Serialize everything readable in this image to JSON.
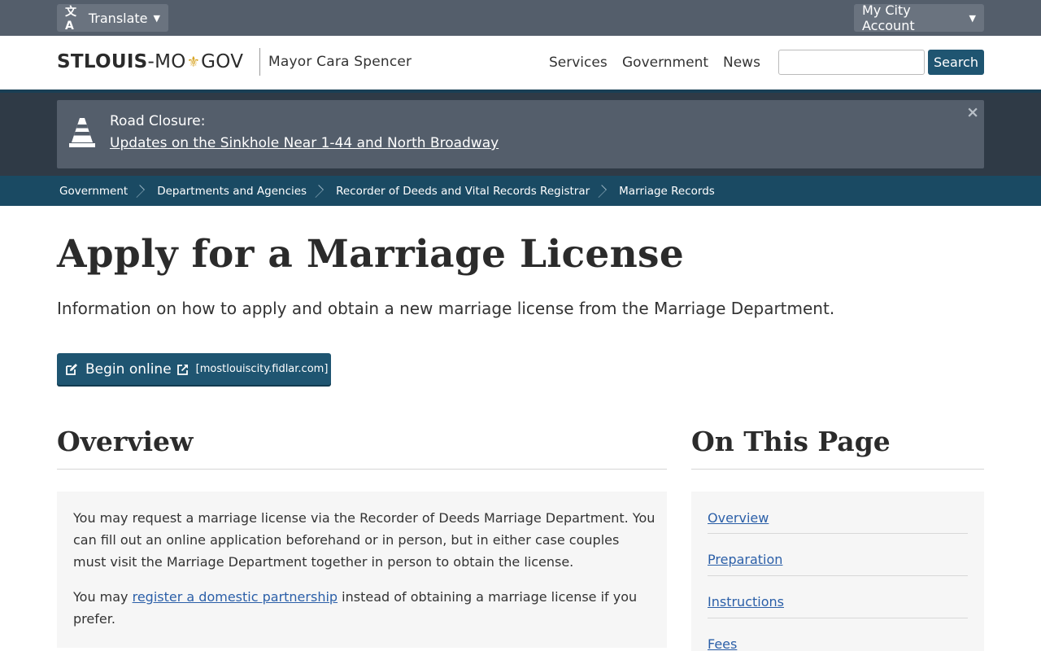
{
  "utility": {
    "translate_label": "Translate",
    "account_label": "My City Account"
  },
  "header": {
    "logo_part1": "STLOUIS",
    "logo_part2": "-MO",
    "logo_part3": "GOV",
    "mayor": "Mayor Cara Spencer",
    "nav": [
      "Services",
      "Government",
      "News"
    ],
    "search_value": "",
    "search_button": "Search"
  },
  "alert": {
    "title": "Road Closure:",
    "link": "Updates on the Sinkhole Near 1-44 and North Broadway",
    "close": "×"
  },
  "breadcrumb": [
    "Government",
    "Departments and Agencies",
    "Recorder of Deeds and Vital Records Registrar",
    "Marriage Records"
  ],
  "main": {
    "title": "Apply for a Marriage License",
    "subtitle": "Information on how to apply and obtain a new marriage license from the Marriage Department.",
    "begin_button": "Begin online",
    "begin_domain": "[mostlouiscity.fidlar.com]"
  },
  "overview": {
    "title": "Overview",
    "para1": "You may request a marriage license via the Recorder of Deeds Marriage Department. You can fill out an online application beforehand or in person, but in either case couples must visit the Marriage Department together in person to obtain the license.",
    "para2_before": "You may ",
    "para2_link": "register a domestic partnership",
    "para2_after": " instead of obtaining a marriage license if you prefer."
  },
  "toc": {
    "title": "On This Page",
    "items": [
      "Overview",
      "Preparation",
      "Instructions",
      "Fees"
    ]
  },
  "colors": {
    "utility_bar": "#545e6b",
    "brand_blue": "#1f5571",
    "breadcrumb_bg": "#1a4a63",
    "alert_band": "#2f3a46",
    "link": "#2b5fa8",
    "fleur": "#d8a526"
  }
}
